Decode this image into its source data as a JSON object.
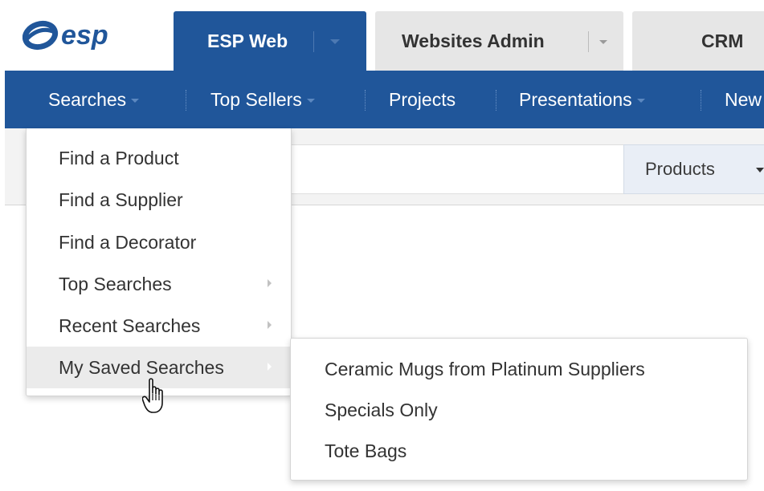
{
  "brand": {
    "logo_text": "esp",
    "color": "#20569a"
  },
  "tabs": [
    {
      "label": "ESP Web",
      "active": true,
      "has_dropdown": true
    },
    {
      "label": "Websites Admin",
      "active": false,
      "has_dropdown": true
    },
    {
      "label": "CRM",
      "active": false,
      "has_dropdown": false
    }
  ],
  "nav": {
    "items": [
      {
        "label": "Searches",
        "has_dropdown": true,
        "open": true
      },
      {
        "label": "Top Sellers",
        "has_dropdown": true
      },
      {
        "label": "Projects",
        "has_dropdown": false
      },
      {
        "label": "Presentations",
        "has_dropdown": true
      },
      {
        "label": "New",
        "has_dropdown": false
      }
    ]
  },
  "search": {
    "category": "Products",
    "value": ""
  },
  "searches_menu": {
    "items": [
      {
        "label": "Find a Product",
        "submenu": false
      },
      {
        "label": "Find a Supplier",
        "submenu": false
      },
      {
        "label": "Find a Decorator",
        "submenu": false
      },
      {
        "label": "Top Searches",
        "submenu": true
      },
      {
        "label": "Recent Searches",
        "submenu": true
      },
      {
        "label": "My Saved Searches",
        "submenu": true,
        "hovered": true
      }
    ]
  },
  "saved_searches_menu": {
    "items": [
      {
        "label": "Ceramic Mugs from Platinum Suppliers"
      },
      {
        "label": "Specials Only"
      },
      {
        "label": "Tote Bags"
      }
    ]
  }
}
